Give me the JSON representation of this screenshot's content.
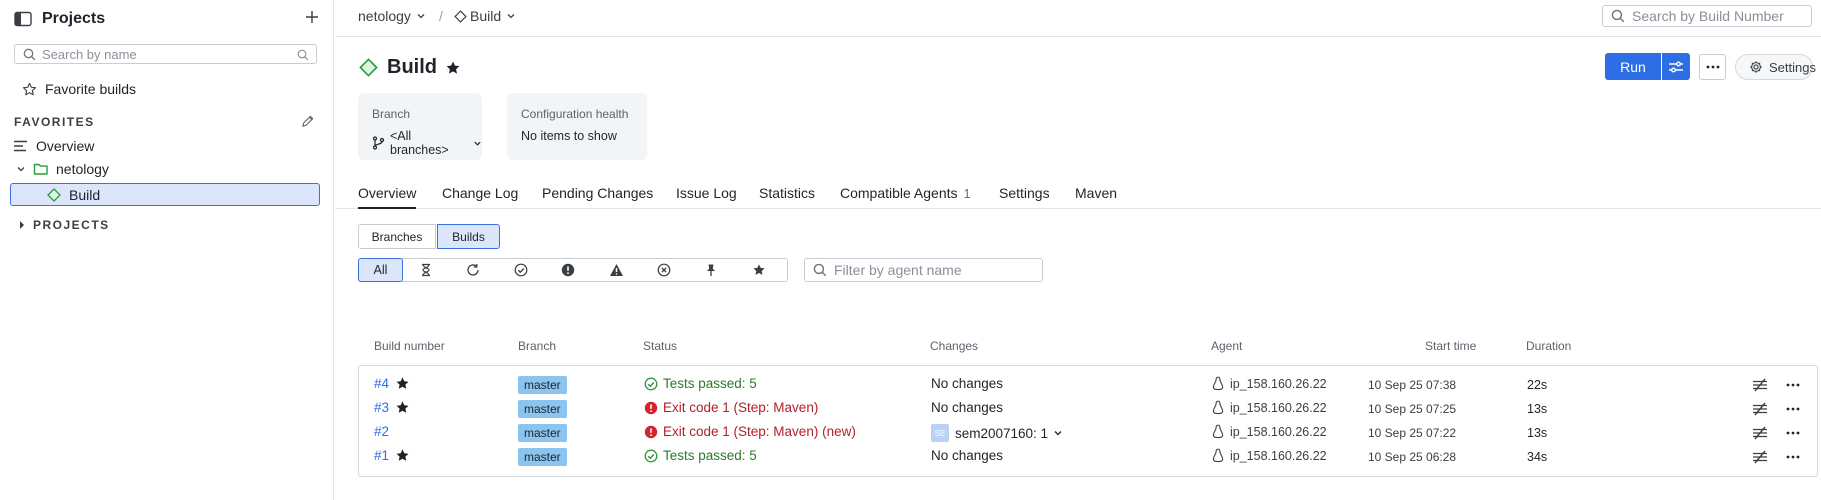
{
  "sidebar": {
    "title": "Projects",
    "search_placeholder": "Search by name",
    "favorite_builds": "Favorite builds",
    "favorites_label": "FAVORITES",
    "items": [
      {
        "label": "Overview"
      },
      {
        "label": "netology"
      },
      {
        "label": "Build"
      }
    ],
    "projects_label": "PROJECTS"
  },
  "topbar": {
    "crumbs": [
      {
        "label": "netology"
      },
      {
        "label": "Build"
      }
    ],
    "separator": "/",
    "search_placeholder": "Search by Build Number"
  },
  "header": {
    "title": "Build",
    "run_label": "Run",
    "settings_label": "Settings"
  },
  "cards": [
    {
      "label": "Branch",
      "value": "<All branches>"
    },
    {
      "label": "Configuration health",
      "value": "No items to show"
    }
  ],
  "tabs": [
    {
      "label": "Overview"
    },
    {
      "label": "Change Log"
    },
    {
      "label": "Pending Changes"
    },
    {
      "label": "Issue Log"
    },
    {
      "label": "Statistics"
    },
    {
      "label": "Compatible Agents",
      "count": "1"
    },
    {
      "label": "Settings"
    },
    {
      "label": "Maven"
    }
  ],
  "view_toggle": [
    {
      "label": "Branches"
    },
    {
      "label": "Builds"
    }
  ],
  "filters": {
    "all_label": "All",
    "icons": [
      "hourglass-icon",
      "running-icon",
      "success-icon",
      "error-icon",
      "warning-icon",
      "failed-icon",
      "pin-icon",
      "star-icon"
    ],
    "agent_placeholder": "Filter by agent name"
  },
  "table": {
    "headers": [
      "Build number",
      "Branch",
      "Status",
      "Changes",
      "Agent",
      "Start time",
      "Duration"
    ],
    "rows": [
      {
        "number": "#4",
        "starred": true,
        "branch": "master",
        "status": "Tests passed: 5",
        "status_type": "success",
        "changes": "No changes",
        "agent": "ip_158.160.26.22",
        "start": "10 Sep 25 07:38",
        "duration": "22s"
      },
      {
        "number": "#3",
        "starred": true,
        "branch": "master",
        "status": "Exit code 1 (Step: Maven)",
        "status_type": "error",
        "changes": "No changes",
        "agent": "ip_158.160.26.22",
        "start": "10 Sep 25 07:25",
        "duration": "13s"
      },
      {
        "number": "#2",
        "starred": false,
        "branch": "master",
        "status": "Exit code 1 (Step: Maven) (new)",
        "status_type": "error",
        "changes": "sem2007160: 1",
        "changes_avatar": "SE",
        "agent": "ip_158.160.26.22",
        "start": "10 Sep 25 07:22",
        "duration": "13s"
      },
      {
        "number": "#1",
        "starred": true,
        "branch": "master",
        "status": "Tests passed: 5",
        "status_type": "success",
        "changes": "No changes",
        "agent": "ip_158.160.26.22",
        "start": "10 Sep 25 06:28",
        "duration": "34s"
      }
    ]
  },
  "colors": {
    "accent": "#2d6ee5",
    "success": "#2c7a2e",
    "error": "#d1242f",
    "branch_tag": "#8cc4f0",
    "selection": "#dbe6fb"
  }
}
